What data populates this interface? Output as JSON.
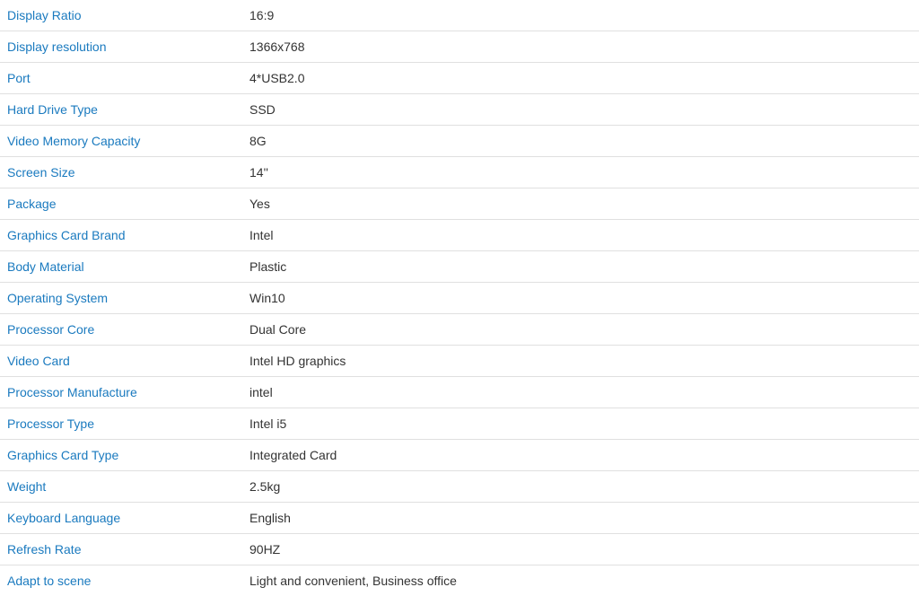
{
  "table": {
    "rows": [
      {
        "label": "Display Ratio",
        "value": "16:9"
      },
      {
        "label": "Display resolution",
        "value": "1366x768"
      },
      {
        "label": "Port",
        "value": "4*USB2.0"
      },
      {
        "label": "Hard Drive Type",
        "value": "SSD"
      },
      {
        "label": "Video Memory Capacity",
        "value": "8G"
      },
      {
        "label": "Screen Size",
        "value": "14''"
      },
      {
        "label": "Package",
        "value": "Yes"
      },
      {
        "label": "Graphics Card Brand",
        "value": "Intel"
      },
      {
        "label": "Body Material",
        "value": "Plastic"
      },
      {
        "label": "Operating System",
        "value": "Win10"
      },
      {
        "label": "Processor Core",
        "value": "Dual Core"
      },
      {
        "label": "Video Card",
        "value": "Intel HD graphics"
      },
      {
        "label": "Processor Manufacture",
        "value": "intel"
      },
      {
        "label": "Processor Type",
        "value": "Intel i5"
      },
      {
        "label": "Graphics Card Type",
        "value": "Integrated Card"
      },
      {
        "label": "Weight",
        "value": "2.5kg"
      },
      {
        "label": "Keyboard Language",
        "value": "English"
      },
      {
        "label": "Refresh Rate",
        "value": "90HZ"
      },
      {
        "label": "Adapt to scene",
        "value": "Light and convenient, Business office"
      }
    ]
  }
}
